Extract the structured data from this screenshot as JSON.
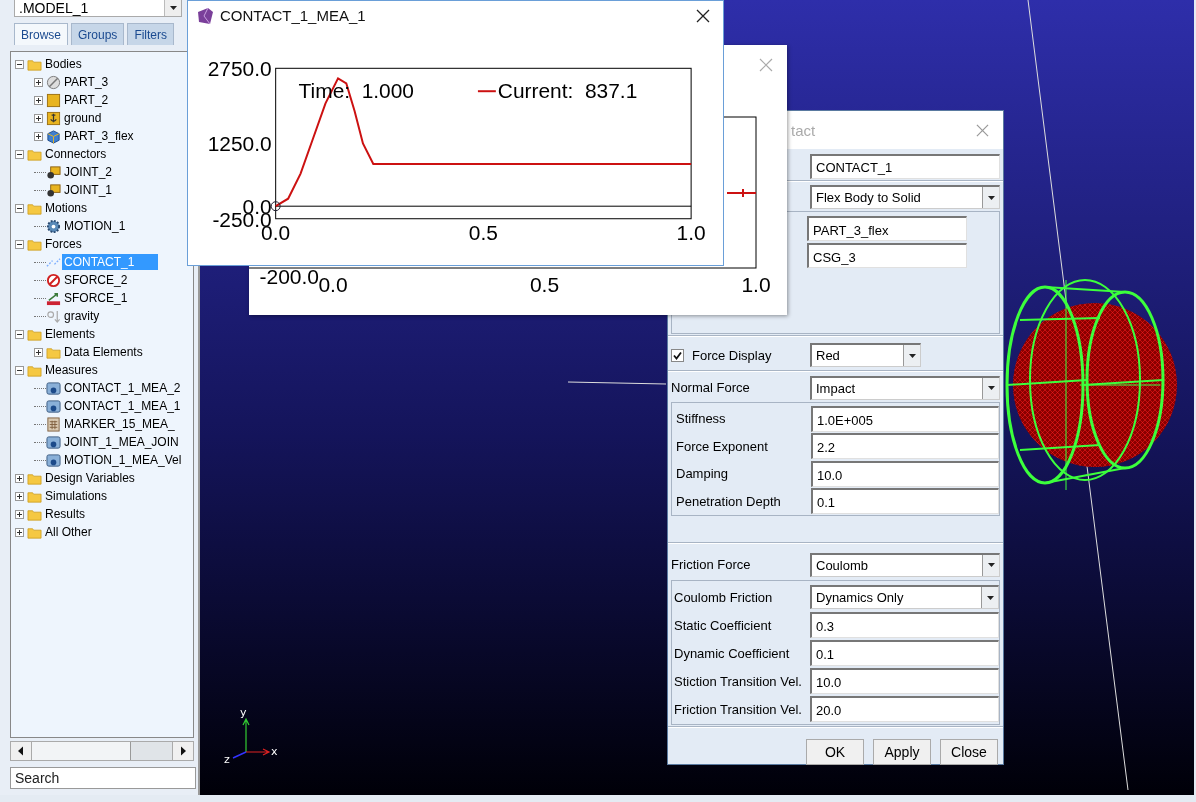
{
  "browser": {
    "model_combo": ".MODEL_1",
    "tabs": [
      {
        "label": "Browse",
        "selected": true
      },
      {
        "label": "Groups",
        "selected": false
      },
      {
        "label": "Filters",
        "selected": false
      }
    ],
    "tree": {
      "items": [
        {
          "label": "Bodies",
          "kind": "folder",
          "expanded": true,
          "selected": false,
          "children": [
            {
              "label": "PART_3",
              "kind": "sphere",
              "expanded": false,
              "selected": false
            },
            {
              "label": "PART_2",
              "kind": "cube",
              "expanded": false,
              "selected": false
            },
            {
              "label": "ground",
              "kind": "anchor",
              "expanded": false,
              "selected": false
            },
            {
              "label": "PART_3_flex",
              "kind": "flex",
              "expanded": false,
              "selected": false
            }
          ]
        },
        {
          "label": "Connectors",
          "kind": "folder",
          "expanded": true,
          "selected": false,
          "children": [
            {
              "label": "JOINT_2",
              "kind": "joint",
              "selected": false
            },
            {
              "label": "JOINT_1",
              "kind": "joint",
              "selected": false
            }
          ]
        },
        {
          "label": "Motions",
          "kind": "folder",
          "expanded": true,
          "selected": false,
          "children": [
            {
              "label": "MOTION_1",
              "kind": "motion",
              "selected": false
            }
          ]
        },
        {
          "label": "Forces",
          "kind": "folder",
          "expanded": true,
          "selected": false,
          "children": [
            {
              "label": "CONTACT_1",
              "kind": "contact",
              "selected": true
            },
            {
              "label": "SFORCE_2",
              "kind": "sforce",
              "selected": false
            },
            {
              "label": "SFORCE_1",
              "kind": "vector",
              "selected": false
            },
            {
              "label": "gravity",
              "kind": "gravity",
              "selected": false
            }
          ]
        },
        {
          "label": "Elements",
          "kind": "folder",
          "expanded": true,
          "selected": false,
          "children": [
            {
              "label": "Data Elements",
              "kind": "folder",
              "expanded": false,
              "selected": false
            }
          ]
        },
        {
          "label": "Measures",
          "kind": "folder",
          "expanded": true,
          "selected": false,
          "children": [
            {
              "label": "CONTACT_1_MEA_2",
              "kind": "measure",
              "selected": false
            },
            {
              "label": "CONTACT_1_MEA_1",
              "kind": "measure",
              "selected": false
            },
            {
              "label": "MARKER_15_MEA_",
              "kind": "calc",
              "selected": false
            },
            {
              "label": "JOINT_1_MEA_JOIN",
              "kind": "measure",
              "selected": false
            },
            {
              "label": "MOTION_1_MEA_Vel",
              "kind": "measure",
              "selected": false
            }
          ]
        },
        {
          "label": "Design Variables",
          "kind": "folder",
          "expanded": false,
          "selected": false
        },
        {
          "label": "Simulations",
          "kind": "folder",
          "expanded": false,
          "selected": false
        },
        {
          "label": "Results",
          "kind": "folder",
          "expanded": false,
          "selected": false
        },
        {
          "label": "All Other",
          "kind": "folder",
          "expanded": false,
          "selected": false
        }
      ]
    },
    "search": {
      "placeholder": "Search"
    }
  },
  "viewport": {
    "triad": {
      "x": "x",
      "y": "y",
      "z": "z"
    }
  },
  "back_plot_window": {
    "x_tick_labels": [
      "0.0",
      "0.5",
      "1.0"
    ],
    "y_tick_label": "-200.0"
  },
  "plot_window": {
    "title": "CONTACT_1_MEA_1",
    "legend_time": "Time:  1.000",
    "legend_text": "Current:  837.1",
    "chart_data": {
      "type": "line",
      "x": [
        0,
        0.03,
        0.06,
        0.09,
        0.12,
        0.15,
        0.17,
        0.19,
        0.21,
        0.235,
        0.5,
        1.0
      ],
      "series": [
        {
          "color": "#cc1111",
          "values": [
            0,
            150,
            650,
            1350,
            2050,
            2550,
            2450,
            1900,
            1250,
            840,
            840,
            840
          ]
        }
      ],
      "xlim": [
        0,
        1
      ],
      "ylim": [
        -250,
        2750
      ],
      "xticks": [
        {
          "value": 0,
          "label": "0.0"
        },
        {
          "value": 0.5,
          "label": "0.5"
        },
        {
          "value": 1,
          "label": "1.0"
        }
      ],
      "yticks": [
        {
          "value": 2750,
          "label": "2750.0"
        },
        {
          "value": 1250,
          "label": "1250.0"
        },
        {
          "value": 0,
          "label": "0.0"
        },
        {
          "value": -250,
          "label": "-250.0"
        }
      ]
    }
  },
  "contact_dialog": {
    "title": "tact",
    "name_field": "CONTACT_1",
    "type_combo": "Flex Body to Solid",
    "body_fields": [
      "PART_3_flex",
      "CSG_3"
    ],
    "force_display": {
      "label": "Force Display",
      "checked": true,
      "value": "Red"
    },
    "normal_force": {
      "label": "Normal Force",
      "value": "Impact",
      "params": [
        {
          "label": "Stiffness",
          "value": "1.0E+005"
        },
        {
          "label": "Force Exponent",
          "value": "2.2"
        },
        {
          "label": "Damping",
          "value": "10.0"
        },
        {
          "label": "Penetration Depth",
          "value": "0.1"
        }
      ]
    },
    "friction_force": {
      "label": "Friction Force",
      "value": "Coulomb",
      "params": [
        {
          "kind": "combo",
          "label": "Coulomb Friction",
          "value": "Dynamics Only"
        },
        {
          "kind": "text",
          "label": "Static Coefficient",
          "value": "0.3"
        },
        {
          "kind": "text",
          "label": "Dynamic Coefficient",
          "value": "0.1"
        },
        {
          "kind": "text",
          "label": "Stiction Transition Vel.",
          "value": "10.0"
        },
        {
          "kind": "text",
          "label": "Friction Transition Vel.",
          "value": "20.0"
        }
      ]
    },
    "buttons": [
      "OK",
      "Apply",
      "Close"
    ]
  }
}
